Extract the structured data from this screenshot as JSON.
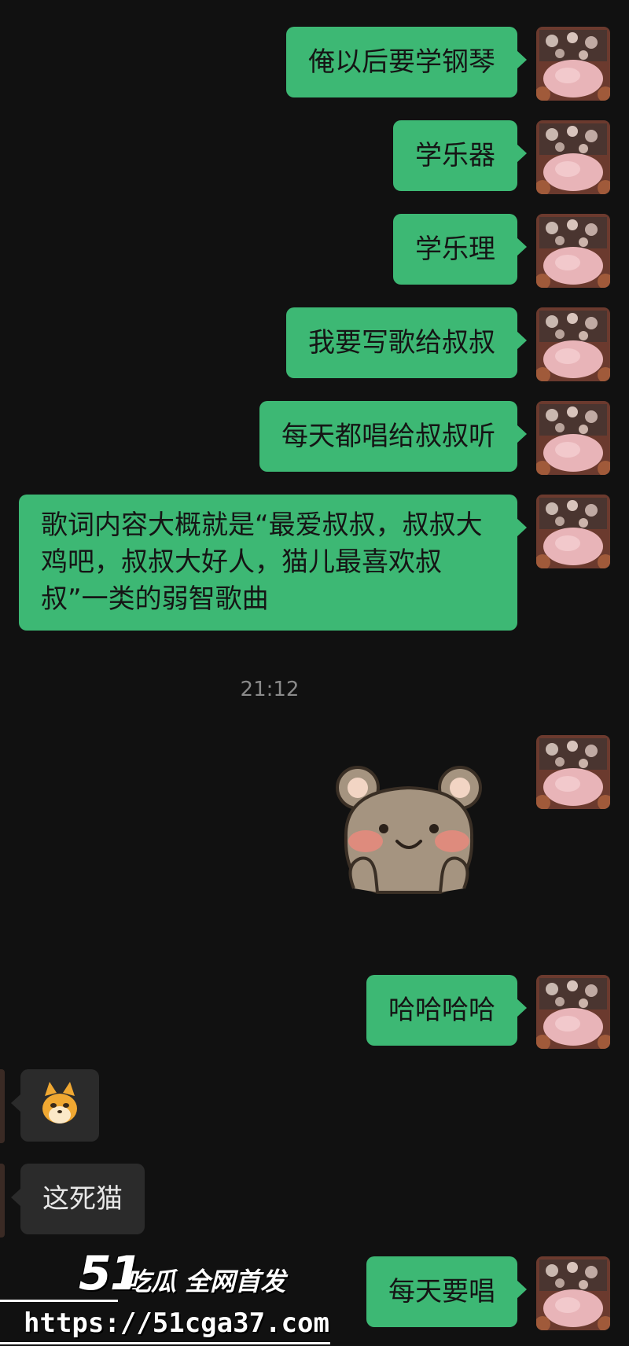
{
  "messages": {
    "m1": "俺以后要学钢琴",
    "m2": "学乐器",
    "m3": "学乐理",
    "m4": "我要写歌给叔叔",
    "m5": "每天都唱给叔叔听",
    "m6": "歌词内容大概就是“最爱叔叔，叔叔大鸡吧，叔叔大好人，猫儿最喜欢叔叔”一类的弱智歌曲",
    "m7": "哈哈哈哈",
    "m8": "这死猫",
    "m9": "每天要唱"
  },
  "timestamp": "21:12",
  "incoming_emoji": "doge-emoji",
  "sticker": "bear-sticker",
  "watermark": {
    "brand_num": "51",
    "brand_text": "吃瓜 全网首发",
    "url": "https://51cga37.com"
  },
  "colors": {
    "background": "#111111",
    "outgoing_bubble": "#3db874",
    "incoming_bubble": "#2b2b2b",
    "timestamp": "#8a8a8a"
  }
}
